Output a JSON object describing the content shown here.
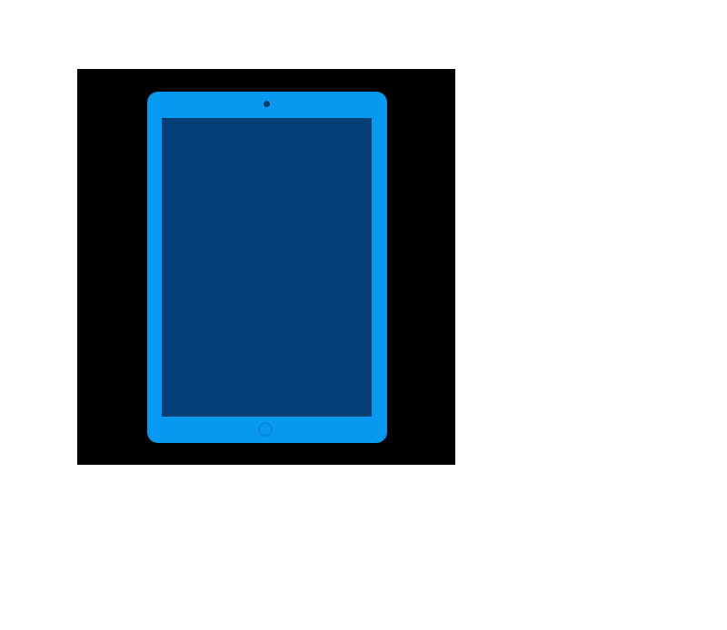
{
  "image": {
    "icon": "tablet-icon",
    "colors": {
      "page_background": "#ffffff",
      "frame_background": "#000000",
      "tablet_body": "#0798ef",
      "tablet_screen": "#033e74",
      "camera": "#0a3b66",
      "home_button_ring": "#0a8ad9"
    }
  }
}
